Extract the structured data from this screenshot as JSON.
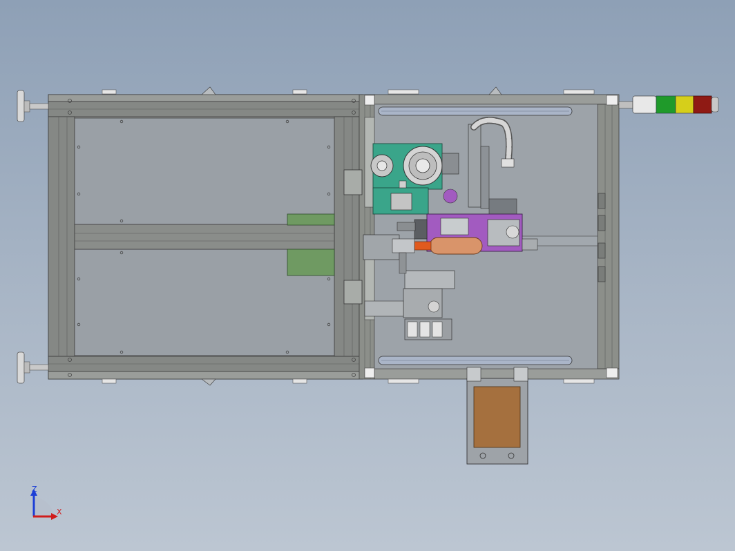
{
  "viewport": {
    "background_top": "#8ea0b6",
    "background_bottom": "#bcc6d2"
  },
  "colors": {
    "frame_gray": "#8c8f8c",
    "frame_dark": "#5e615e",
    "panel_gray": "#9da3a8",
    "plate_green": "#6f9a62",
    "mech_teal": "#3aa58a",
    "mech_purple": "#a25bc0",
    "roller_copper": "#d9946a",
    "nozzle_orange": "#e05a1e",
    "tray_brown": "#a5703e",
    "light_white": "#e8e8e8",
    "light_green": "#1f9a2a",
    "light_yellow": "#d6cf1a",
    "light_red": "#8f1a14",
    "axis_z": "#1d3fd6",
    "axis_x": "#d01c1c"
  },
  "signal_tower": {
    "segments": [
      "white",
      "green",
      "yellow",
      "red"
    ]
  },
  "triad": {
    "z_label": "Z",
    "x_label": "X",
    "icon": "coordinate-triad-icon"
  }
}
